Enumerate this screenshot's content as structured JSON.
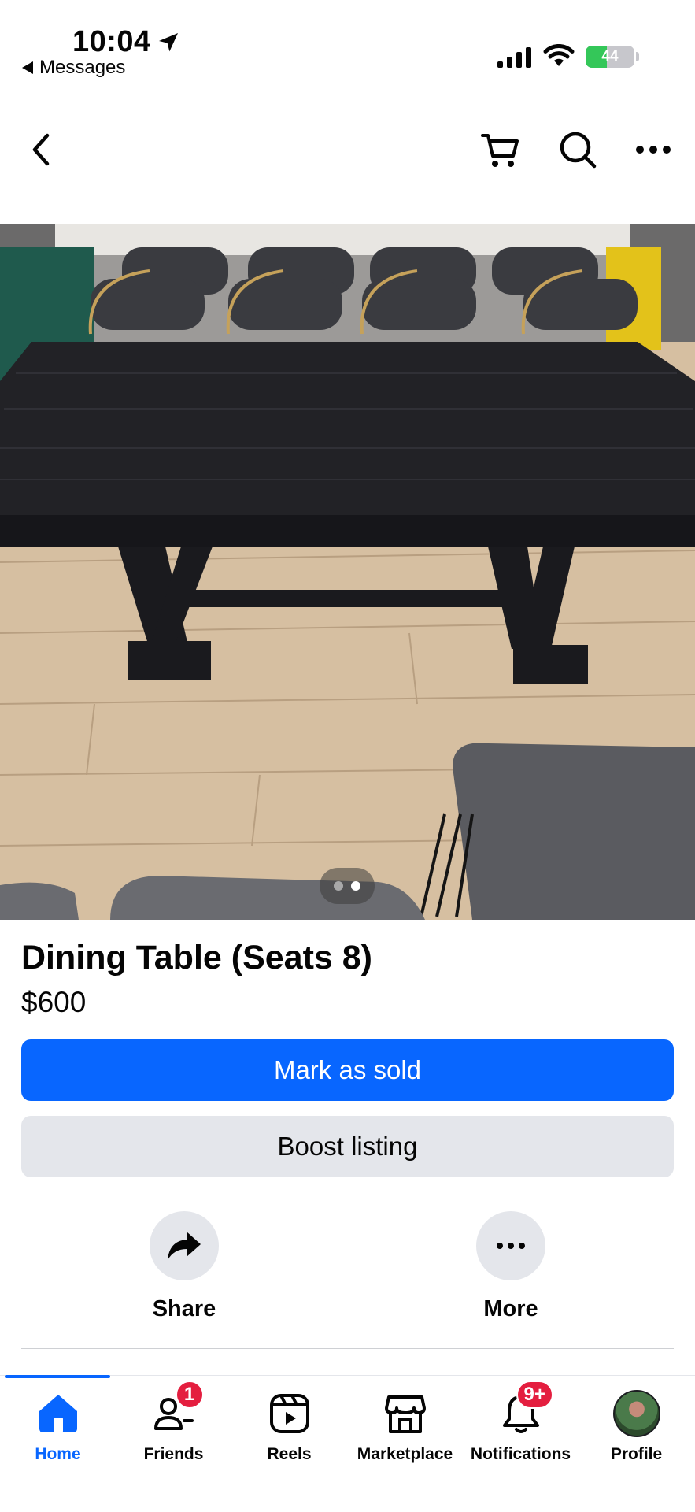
{
  "status_bar": {
    "time": "10:04",
    "back_app_label": "Messages",
    "battery_percent": "44",
    "battery_level": 0.44
  },
  "header": {
    "back_icon": "chevron-left-icon",
    "cart_icon": "cart-icon",
    "search_icon": "search-icon",
    "more_icon": "more-horizontal-icon"
  },
  "photo": {
    "description_icon": "listing-photo",
    "page_count": 2,
    "active_page": 2
  },
  "listing": {
    "title": "Dining Table (Seats 8)",
    "price": "$600",
    "mark_sold_label": "Mark as sold",
    "boost_label": "Boost listing"
  },
  "actions": {
    "share_label": "Share",
    "more_label": "More"
  },
  "nav": {
    "items": [
      {
        "label": "Home",
        "icon": "home-icon",
        "active": true
      },
      {
        "label": "Friends",
        "icon": "friends-icon",
        "badge": "1"
      },
      {
        "label": "Reels",
        "icon": "reels-icon"
      },
      {
        "label": "Marketplace",
        "icon": "marketplace-icon"
      },
      {
        "label": "Notifications",
        "icon": "bell-icon",
        "badge": "9+"
      },
      {
        "label": "Profile",
        "icon": "avatar"
      }
    ]
  },
  "colors": {
    "accent": "#0866ff",
    "badge": "#e41e3f",
    "secondary_button": "#e4e6eb"
  }
}
